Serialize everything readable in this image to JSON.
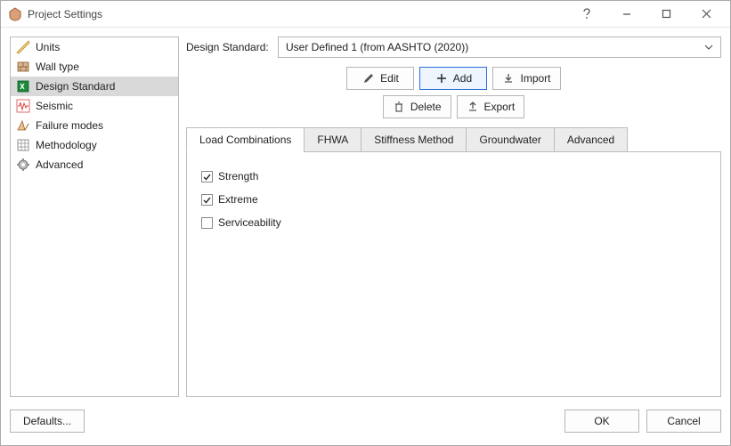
{
  "window": {
    "title": "Project Settings"
  },
  "sidebar": {
    "items": [
      {
        "label": "Units"
      },
      {
        "label": "Wall type"
      },
      {
        "label": "Design Standard"
      },
      {
        "label": "Seismic"
      },
      {
        "label": "Failure modes"
      },
      {
        "label": "Methodology"
      },
      {
        "label": "Advanced"
      }
    ],
    "selected_index": 2
  },
  "design_standard": {
    "label": "Design Standard:",
    "value": "User Defined 1 (from AASHTO (2020))"
  },
  "toolbar": {
    "edit": "Edit",
    "add": "Add",
    "import": "Import",
    "delete": "Delete",
    "export": "Export"
  },
  "tabs": {
    "items": [
      {
        "label": "Load Combinations"
      },
      {
        "label": "FHWA"
      },
      {
        "label": "Stiffness Method"
      },
      {
        "label": "Groundwater"
      },
      {
        "label": "Advanced"
      }
    ],
    "active_index": 0
  },
  "load_combinations": {
    "strength": {
      "label": "Strength",
      "checked": true
    },
    "extreme": {
      "label": "Extreme",
      "checked": true
    },
    "serviceability": {
      "label": "Serviceability",
      "checked": false
    }
  },
  "footer": {
    "defaults": "Defaults...",
    "ok": "OK",
    "cancel": "Cancel"
  }
}
